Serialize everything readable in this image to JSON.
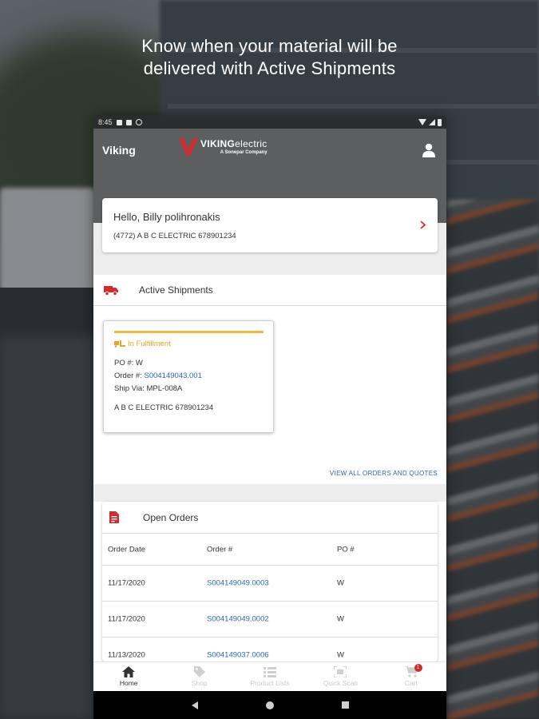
{
  "headline": {
    "line1": "Know when your material will be",
    "line2": "delivered with Active Shipments"
  },
  "statusbar": {
    "time": "8:45"
  },
  "appbar": {
    "title": "Viking",
    "brand_bold": "VIKING",
    "brand_light": "electric",
    "brand_tagline": "A Sonepar Company",
    "icon": "account-icon"
  },
  "greeting": {
    "hello": "Hello, Billy polihronakis",
    "account": "(4772) A B C ELECTRIC 678901234"
  },
  "active_shipments": {
    "title": "Active Shipments",
    "card": {
      "status": "In Fulfillment",
      "po": "PO #: W",
      "order_label": "Order #: ",
      "order_number": "S004149043.001",
      "ship_via": "Ship Via: MPL-008A",
      "customer": "A B C ELECTRIC 678901234"
    },
    "view_all": "VIEW ALL ORDERS AND QUOTES"
  },
  "open_orders": {
    "title": "Open Orders",
    "headers": [
      "Order Date",
      "Order #",
      "PO #"
    ],
    "rows": [
      {
        "date": "11/17/2020",
        "order": "S004149049.0003",
        "po": "W"
      },
      {
        "date": "11/17/2020",
        "order": "S004149049.0002",
        "po": "W"
      },
      {
        "date": "11/13/2020",
        "order": "S004149037.0006",
        "po": "W"
      }
    ]
  },
  "bottom_nav": [
    {
      "label": "Home",
      "icon": "home-icon",
      "active": true
    },
    {
      "label": "Shop",
      "icon": "tag-icon",
      "active": false
    },
    {
      "label": "Product Lists",
      "icon": "list-icon",
      "active": false
    },
    {
      "label": "Quick Scan",
      "icon": "scan-icon",
      "active": false
    },
    {
      "label": "Cart",
      "icon": "cart-icon",
      "active": false,
      "badge": "1"
    }
  ],
  "colors": {
    "brand_red": "#d12b2b",
    "appbar_grey": "#5d5e60",
    "link_blue": "#2a66b3",
    "status_amber": "#f0b73a"
  }
}
